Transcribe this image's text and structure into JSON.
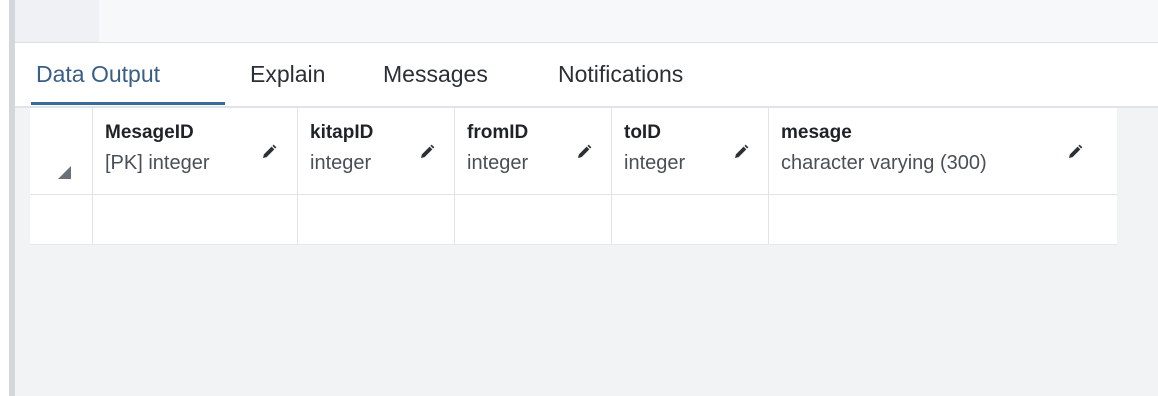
{
  "tabs": [
    {
      "label": "Data Output",
      "active": true
    },
    {
      "label": "Explain",
      "active": false
    },
    {
      "label": "Messages",
      "active": false
    },
    {
      "label": "Notifications",
      "active": false
    }
  ],
  "columns": [
    {
      "name": "MesageID",
      "type": "[PK] integer"
    },
    {
      "name": "kitapID",
      "type": "integer"
    },
    {
      "name": "fromID",
      "type": "integer"
    },
    {
      "name": "toID",
      "type": "integer"
    },
    {
      "name": "mesage",
      "type": "character varying (300)"
    }
  ],
  "rows": [
    [
      "",
      "",
      "",
      "",
      ""
    ]
  ],
  "colors": {
    "accent": "#3a6a99",
    "background": "#f2f3f5",
    "grid_background": "#ffffff"
  }
}
